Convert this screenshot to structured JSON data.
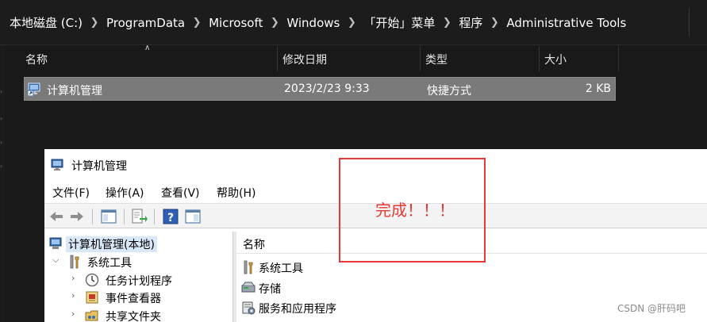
{
  "breadcrumb": {
    "items": [
      "本地磁盘 (C:)",
      "ProgramData",
      "Microsoft",
      "Windows",
      "「开始」菜单",
      "程序",
      "Administrative Tools"
    ]
  },
  "explorer": {
    "columns": [
      "名称",
      "修改日期",
      "类型",
      "大小"
    ],
    "file": {
      "name": "计算机管理",
      "date": "2023/2/23 9:33",
      "type": "快捷方式",
      "size": "2 KB"
    }
  },
  "mmc": {
    "title": "计算机管理",
    "menu": [
      "文件(F)",
      "操作(A)",
      "查看(V)",
      "帮助(H)"
    ],
    "tree": {
      "root": "计算机管理(本地)",
      "group": "系统工具",
      "children": [
        "任务计划程序",
        "事件查看器",
        "共享文件夹"
      ]
    },
    "content": {
      "header": "名称",
      "items": [
        "系统工具",
        "存储",
        "服务和应用程序"
      ]
    }
  },
  "annotation": {
    "text": "完成！！！"
  },
  "watermark": "CSDN @肝码吧",
  "colors": {
    "background": "#191919",
    "selected_row": "#7a7a7a",
    "annotation": "#e53935",
    "tree_selected": "#d9e8f7"
  }
}
